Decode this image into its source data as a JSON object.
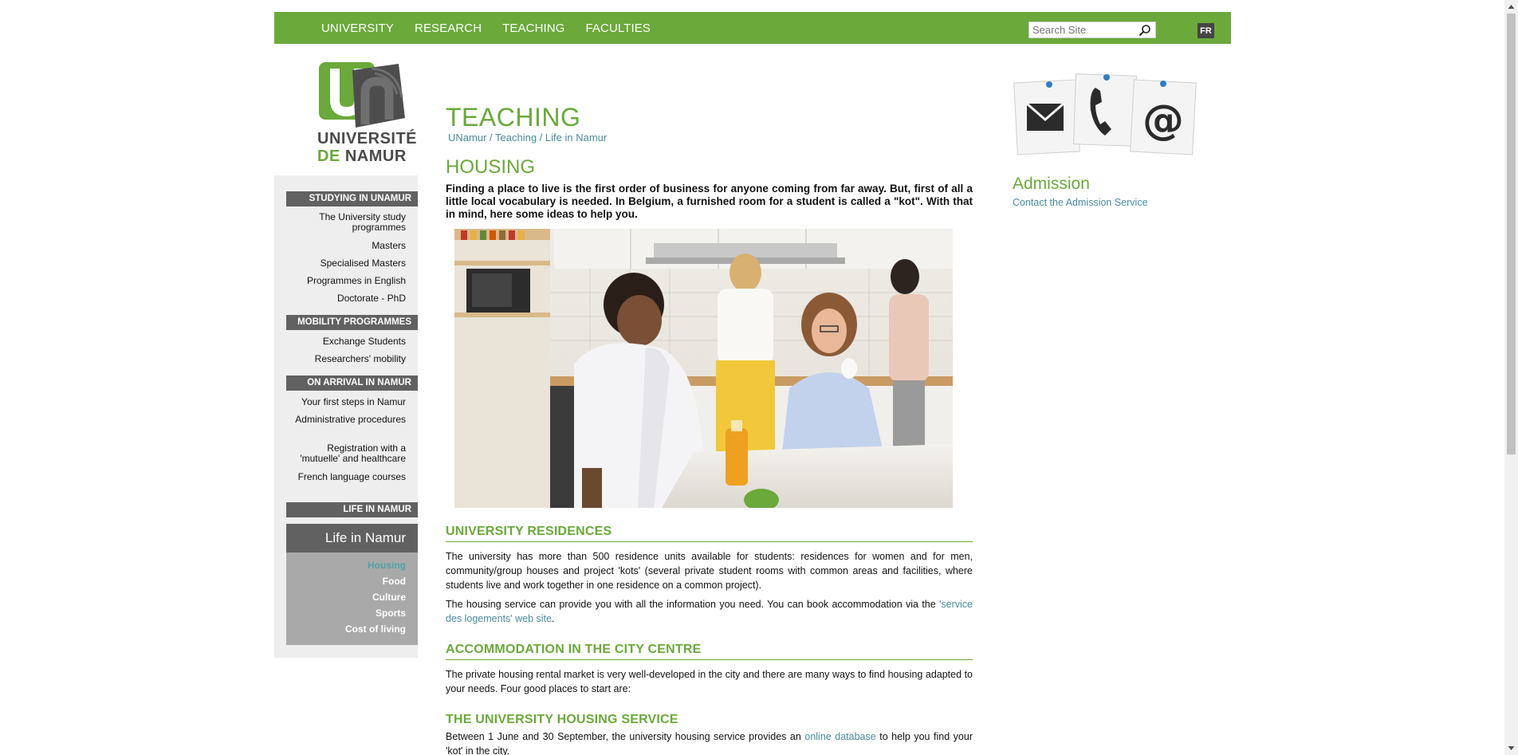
{
  "topnav": {
    "items": [
      "UNIVERSITY",
      "RESEARCH",
      "TEACHING",
      "FACULTIES"
    ],
    "search_placeholder": "Search Site",
    "lang": "FR"
  },
  "logo": {
    "line1": "UNIVERSITÉ",
    "line2_de": "DE",
    "line2_name": "NAMUR"
  },
  "sidebar": {
    "sections": [
      {
        "title": "STUDYING IN UNAMUR",
        "items": [
          "The University study programmes",
          "Masters",
          "Specialised Masters",
          "Programmes in English",
          "Doctorate - PhD"
        ]
      },
      {
        "title": "MOBILITY PROGRAMMES",
        "items": [
          "Exchange Students",
          "Researchers' mobility"
        ]
      },
      {
        "title": "ON ARRIVAL IN NAMUR",
        "items": [
          "Your first steps in Namur",
          "Administrative procedures",
          "Registration with a 'mutuelle' and healthcare",
          "French language courses"
        ]
      },
      {
        "title": "LIFE IN NAMUR",
        "items": []
      }
    ],
    "current": "Life in Namur",
    "sub_items": [
      "Housing",
      "Food",
      "Culture",
      "Sports",
      "Cost of living"
    ]
  },
  "main": {
    "title": "TEACHING",
    "breadcrumb": [
      "UNamur",
      "Teaching",
      "Life in Namur"
    ],
    "breadcrumb_sep": " / ",
    "heading": "HOUSING",
    "intro": "Finding a place to live is the first order of business for anyone coming from far away. But, first of all a little local vocabulary is needed. In Belgium, a furnished room for a student is called a \"kot\". With that in mind, here some ideas to help you.",
    "s1_title": "UNIVERSITY RESIDENCES",
    "s1_p1": "The university has more than 500 residence units available for students: residences for women and for men, community/group houses and project 'kots' (several private student rooms with common areas and facilities, where students live and work together in one residence on a common project).",
    "s1_p2_before": "The housing service can provide you with all the information you need. You can book accommodation via the ",
    "s1_p2_link": "'service des logements' web site",
    "s1_p2_after": ".",
    "s2_title": "ACCOMMODATION IN THE CITY CENTRE",
    "s2_p1": "The private housing rental market is very well-developed in the city and there are many ways to find housing adapted to your needs. Four good places to start are:",
    "s3_title": "THE UNIVERSITY HOUSING SERVICE",
    "s3_p1_before": "Between 1 June and 30 September, the university housing service provides an ",
    "s3_p1_link": "online database",
    "s3_p1_after": " to help you find your 'kot' in the city."
  },
  "right": {
    "admission_title": "Admission",
    "admission_link": "Contact the Admission Service"
  },
  "colors": {
    "green": "#6aa93a",
    "dark_grey": "#616161",
    "link_teal": "#4a8a9a"
  }
}
